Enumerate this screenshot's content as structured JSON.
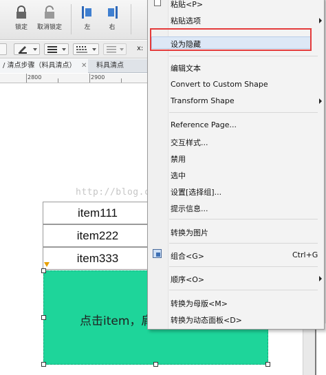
{
  "toolbar": {
    "buttons": [
      {
        "label": "锁定",
        "icon": "lock-icon"
      },
      {
        "label": "取消锁定",
        "icon": "unlock-icon"
      },
      {
        "label": "左",
        "icon": "align-left-icon"
      },
      {
        "label": "右",
        "icon": "align-right-icon"
      }
    ],
    "x_label": "x:"
  },
  "tabs": [
    {
      "label": "/ 清点步骤（料具清点）",
      "active": true
    },
    {
      "label": "料具清点",
      "active": false
    }
  ],
  "ruler": {
    "marks": [
      "2800",
      "2900"
    ]
  },
  "canvas": {
    "rows": [
      "item111",
      "item222",
      "item333"
    ],
    "green_box_text": "点击item，肩",
    "green_color": "#1ed59a"
  },
  "watermark": "http://blog.csdn.net/facffac",
  "context_menu": {
    "items": [
      {
        "label": "粘贴<P>"
      },
      {
        "label": "粘贴选项",
        "submenu": true
      },
      {
        "label": "设为隐藏",
        "highlighted": true
      },
      {
        "label": "编辑文本"
      },
      {
        "label": "Convert to Custom Shape"
      },
      {
        "label": "Transform Shape",
        "submenu": true
      },
      {
        "label": "Reference Page..."
      },
      {
        "label": "交互样式..."
      },
      {
        "label": "禁用"
      },
      {
        "label": "选中"
      },
      {
        "label": "设置[选择组]..."
      },
      {
        "label": "提示信息..."
      },
      {
        "label": "转换为图片"
      },
      {
        "label": "组合<G>",
        "shortcut": "Ctrl+G",
        "icon": "group-icon"
      },
      {
        "label": "顺序<O>",
        "submenu": true
      },
      {
        "label": "转换为母版<M>"
      },
      {
        "label": "转换为动态面板<D>"
      }
    ],
    "highlight_color": "#e43a3a"
  }
}
